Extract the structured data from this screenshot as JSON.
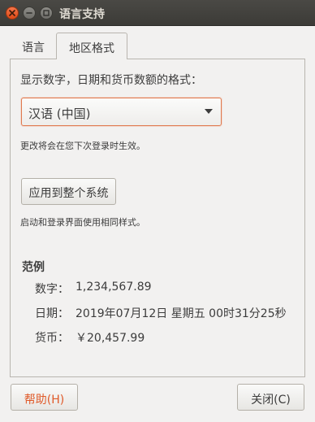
{
  "window": {
    "title": "语言支持"
  },
  "tabs": [
    {
      "label": "语言",
      "active": false
    },
    {
      "label": "地区格式",
      "active": true
    }
  ],
  "regional": {
    "format_label": "显示数字，日期和货币数额的格式：",
    "format_select": {
      "selected": "汉语 (中国)",
      "icon": "chevron-down-icon"
    },
    "change_note": "更改将会在您下次登录时生效。",
    "apply_button": "应用到整个系统",
    "apply_note": "启动和登录界面使用相同样式。",
    "example": {
      "title": "范例",
      "rows": [
        {
          "label": "数字：",
          "value": "1,234,567.89"
        },
        {
          "label": "日期：",
          "value": "2019年07月12日 星期五 00时31分25秒"
        },
        {
          "label": "货币：",
          "value": "￥20,457.99"
        }
      ]
    }
  },
  "footer": {
    "help_button": "帮助(H)",
    "close_button": "关闭(C)"
  },
  "colors": {
    "accent": "#e95420",
    "titlebar": "#3c3b37",
    "window_bg": "#f2f1f0"
  }
}
